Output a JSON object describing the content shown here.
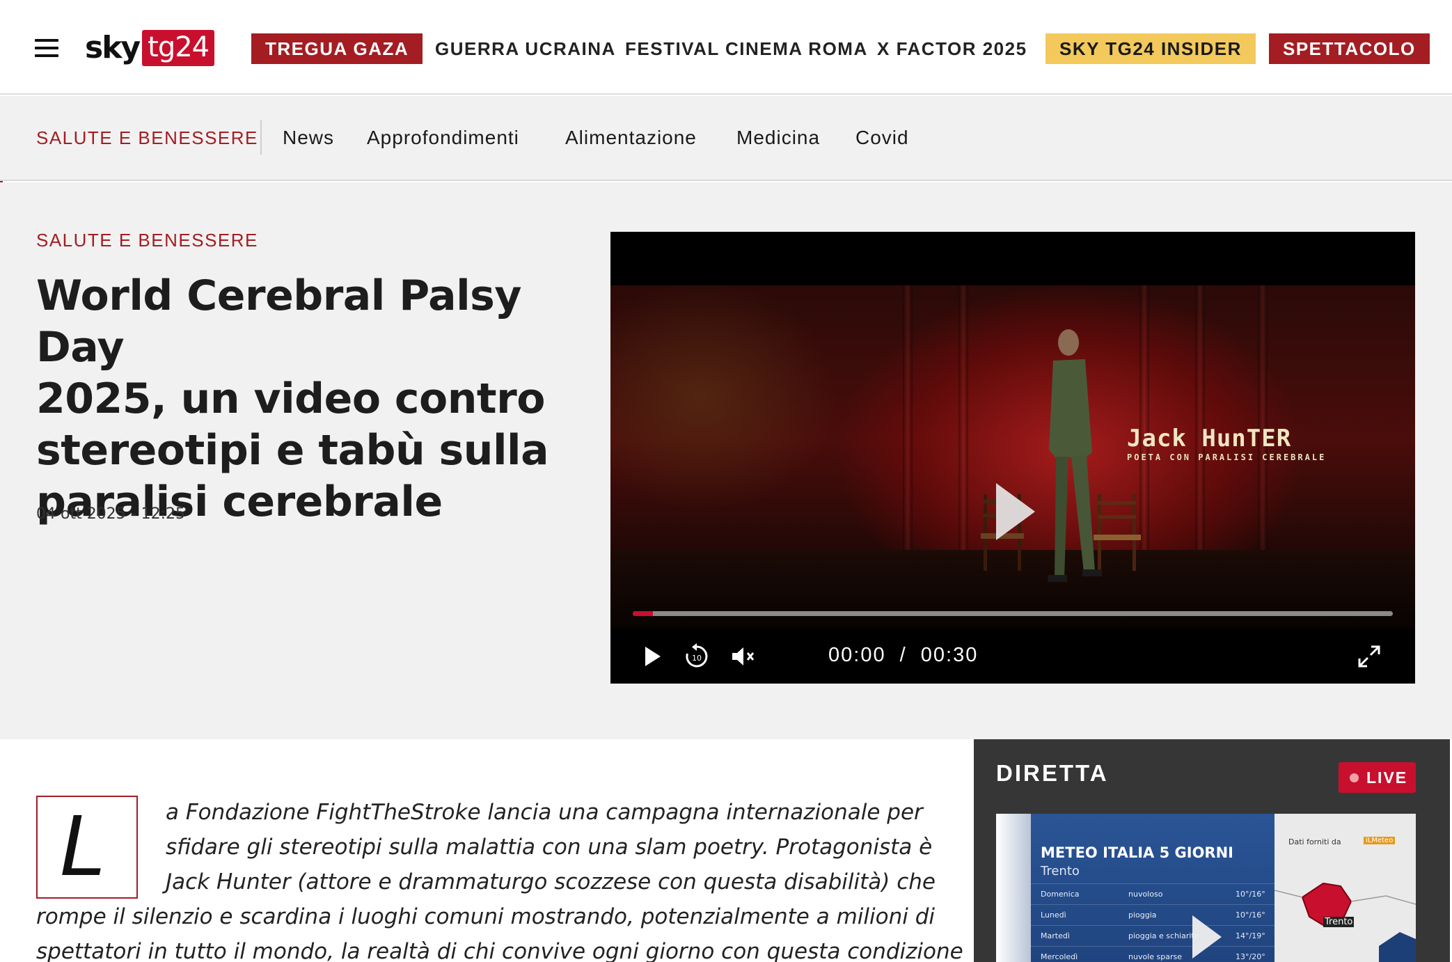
{
  "header": {
    "logo_sky": "sky",
    "logo_tg": "tg24",
    "nav": [
      "TREGUA GAZA",
      "GUERRA UCRAINA",
      "FESTIVAL CINEMA ROMA",
      "X FACTOR 2025",
      "SKY TG24 INSIDER",
      "SPETTACOLO"
    ],
    "colors": {
      "brand_red": "#a31d23",
      "insider_yellow": "#f3c95c"
    }
  },
  "subnav": {
    "section": "SALUTE E BENESSERE",
    "items": [
      "News",
      "Approfondimenti",
      "Alimentazione",
      "Medicina",
      "Covid"
    ]
  },
  "article": {
    "section": "SALUTE E BENESSERE",
    "title_lines": [
      "World Cerebral Palsy Day",
      "2025, un video contro",
      "stereotipi e tabù sulla",
      "paralisi cerebrale"
    ],
    "date": "04 ott 2025 - 12:25",
    "dropcap": "L",
    "body_lines": [
      "a Fondazione FightTheStroke lancia una campagna internazionale per",
      "sfidare gli stereotipi sulla malattia con una slam poetry. Protagonista è",
      "Jack Hunter (attore e drammaturgo scozzese con questa disabilità) che",
      "rompe il silenzio e scardina i luoghi comuni mostrando, potenzialmente a milioni di",
      "spettatori in tutto il mondo, la realtà di chi convive ogni giorno con questa condizione"
    ]
  },
  "video": {
    "overlay_name": "Jack HunTER",
    "overlay_subtitle": "POETA CON PARALISI CEREBRALE",
    "current_time": "00:00",
    "separator": "/",
    "duration": "00:30",
    "progress": 0.027,
    "icons": [
      "play-icon",
      "replay-10-icon",
      "mute-icon",
      "fullscreen-icon"
    ]
  },
  "diretta": {
    "title": "DIRETTA",
    "live_label": "LIVE",
    "thumb": {
      "title": "METEO ITALIA 5 GIORNI",
      "city": "Trento",
      "rows": [
        {
          "day": "Domenica",
          "cond": "nuvoloso",
          "temp": "10°/16°"
        },
        {
          "day": "Lunedì",
          "cond": "pioggia",
          "temp": "10°/16°"
        },
        {
          "day": "Martedì",
          "cond": "pioggia e schiarite",
          "temp": "14°/19°"
        },
        {
          "day": "Mercoledì",
          "cond": "nuvole sparse",
          "temp": "13°/20°"
        }
      ],
      "credit": "Dati forniti da",
      "credit_brand": "iLMeteo",
      "map_city": "Trento"
    }
  }
}
